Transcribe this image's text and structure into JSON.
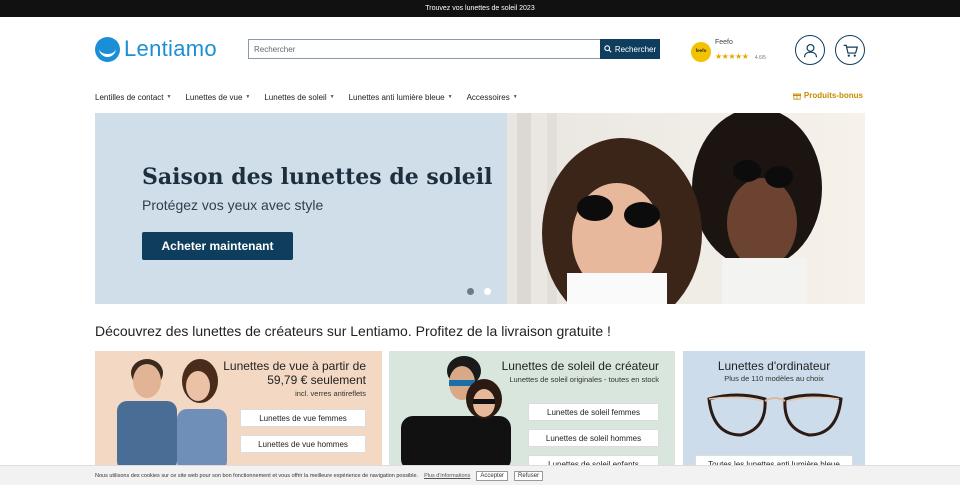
{
  "topbar": {
    "text": "Trouvez vos lunettes de soleil 2023"
  },
  "brand": {
    "name": "Lentiamo",
    "color": "#1a8fd6"
  },
  "search": {
    "placeholder": "Rechercher",
    "button_label": "Rechercher"
  },
  "feefo": {
    "badge": "feefo",
    "name": "Feefo",
    "stars": "★★★★★",
    "score": "4.6/5"
  },
  "icons": {
    "account": "user-icon",
    "cart": "cart-icon",
    "search": "search-icon",
    "bonus": "gift-icon"
  },
  "nav": {
    "items": [
      {
        "label": "Lentilles de contact"
      },
      {
        "label": "Lunettes de vue"
      },
      {
        "label": "Lunettes de soleil"
      },
      {
        "label": "Lunettes anti lumière bleue"
      },
      {
        "label": "Accessoires"
      }
    ],
    "bonus_label": "Produits-bonus"
  },
  "hero": {
    "title": "Saison des lunettes de soleil",
    "subtitle": "Protégez vos yeux avec style",
    "cta": "Acheter maintenant",
    "active_slide": 1,
    "slides": 2
  },
  "tagline": "Découvrez des lunettes de créateurs sur Lentiamo. Profitez de la livraison gratuite !",
  "cards": [
    {
      "title": "Lunettes de vue à partir de 59,79 € seulement",
      "subtitle": "incl. verres antireflets",
      "buttons": [
        "Lunettes de vue femmes",
        "Lunettes de vue hommes"
      ]
    },
    {
      "title": "Lunettes de soleil de créateur",
      "subtitle": "Lunettes de soleil originales - toutes en stock",
      "buttons": [
        "Lunettes de soleil femmes",
        "Lunettes de soleil hommes",
        "Lunettes de soleil enfants"
      ]
    },
    {
      "title": "Lunettes d'ordinateur",
      "subtitle": "Plus de 110 modèles au choix",
      "buttons": [
        "Toutes les lunettes anti lumière bleue"
      ]
    }
  ],
  "cookie": {
    "text": "Nous utilisons des cookies sur ce site web pour son bon fonctionnement et vous offrir la meilleure expérience de navigation possible.",
    "more_link": "Plus d'informations",
    "accept": "Accepter",
    "refuse": "Refuser"
  },
  "colors": {
    "primary": "#0f3d5e",
    "hero_bg": "#cfdee9",
    "bonus": "#c98a00"
  }
}
